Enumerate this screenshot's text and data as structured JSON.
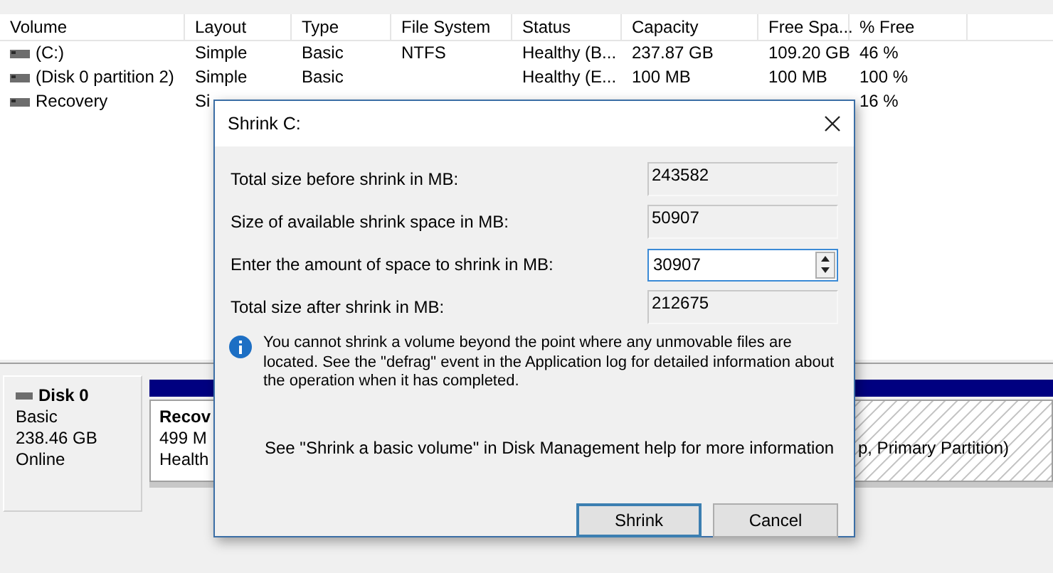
{
  "volume_table": {
    "columns": [
      "Volume",
      "Layout",
      "Type",
      "File System",
      "Status",
      "Capacity",
      "Free Spa...",
      "% Free"
    ],
    "rows": [
      {
        "cells": [
          "(C:)",
          "Simple",
          "Basic",
          "NTFS",
          "Healthy (B...",
          "237.87 GB",
          "109.20 GB",
          "46 %"
        ]
      },
      {
        "cells": [
          "(Disk 0 partition 2)",
          "Simple",
          "Basic",
          "",
          "Healthy (E...",
          "100 MB",
          "100 MB",
          "100 %"
        ]
      },
      {
        "cells": [
          "Recovery",
          "Si",
          null,
          null,
          null,
          null,
          null,
          "16 %"
        ]
      }
    ]
  },
  "disk_map": {
    "disk": {
      "name": "Disk 0",
      "type": "Basic",
      "size": "238.46 GB",
      "status": "Online"
    },
    "partitions": [
      {
        "name": "Recov",
        "size": "499 M",
        "status": "Health",
        "selected": false
      },
      {
        "status": "p, Primary Partition)",
        "selected": true
      }
    ]
  },
  "dialog": {
    "title": "Shrink C:",
    "fields": [
      {
        "label": "Total size before shrink in MB:",
        "value": "243582",
        "kind": "readonly"
      },
      {
        "label": "Size of available shrink space in MB:",
        "value": "50907",
        "kind": "readonly"
      },
      {
        "label": "Enter the amount of space to shrink in MB:",
        "value": "30907",
        "kind": "spin"
      },
      {
        "label": "Total size after shrink in MB:",
        "value": "212675",
        "kind": "readonly"
      }
    ],
    "info": "You cannot shrink a volume beyond the point where any unmovable files are located. See the \"defrag\" event in the Application log for detailed information about the operation when it has completed.",
    "help": "See \"Shrink a basic volume\" in Disk Management help for more information",
    "buttons": [
      {
        "label": "Shrink",
        "default": true
      },
      {
        "label": "Cancel",
        "default": false
      }
    ]
  }
}
